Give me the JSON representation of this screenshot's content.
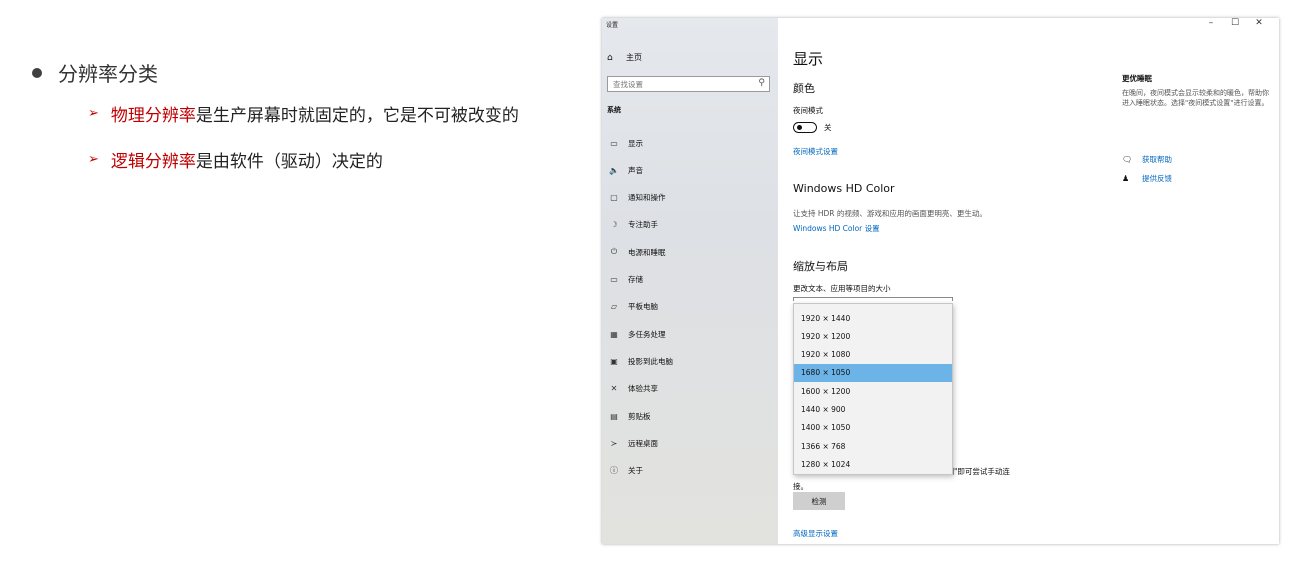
{
  "slide": {
    "bullet": "分辨率分类",
    "sub_items": [
      {
        "highlight": "物理分辨率",
        "rest": "是生产屏幕时就固定的，它是不可被改变的"
      },
      {
        "highlight": "逻辑分辨率",
        "rest": "是由软件（驱动）决定的"
      }
    ]
  },
  "window": {
    "title": "设置",
    "controls": {
      "minimize": "–",
      "maximize": "☐",
      "close": "✕"
    },
    "sidebar": {
      "home": "主页",
      "search_placeholder": "查找设置",
      "section": "系统",
      "items": [
        {
          "label": "显示",
          "icon": "monitor-icon",
          "glyph": "▭"
        },
        {
          "label": "声音",
          "icon": "speaker-icon",
          "glyph": "🔈"
        },
        {
          "label": "通知和操作",
          "icon": "notification-icon",
          "glyph": "▢"
        },
        {
          "label": "专注助手",
          "icon": "moon-icon",
          "glyph": "☽"
        },
        {
          "label": "电源和睡眠",
          "icon": "power-icon",
          "glyph": "⏻"
        },
        {
          "label": "存储",
          "icon": "storage-icon",
          "glyph": "▭"
        },
        {
          "label": "平板电脑",
          "icon": "tablet-icon",
          "glyph": "▱"
        },
        {
          "label": "多任务处理",
          "icon": "multitask-icon",
          "glyph": "▦"
        },
        {
          "label": "投影到此电脑",
          "icon": "project-icon",
          "glyph": "▣"
        },
        {
          "label": "体验共享",
          "icon": "share-icon",
          "glyph": "✕"
        },
        {
          "label": "剪贴板",
          "icon": "clipboard-icon",
          "glyph": "▤"
        },
        {
          "label": "远程桌面",
          "icon": "remote-icon",
          "glyph": "≻"
        },
        {
          "label": "关于",
          "icon": "info-icon",
          "glyph": "ⓘ"
        }
      ]
    },
    "main": {
      "title": "显示",
      "color_heading": "颜色",
      "night_mode_label": "夜间模式",
      "night_mode_state": "关",
      "night_mode_link": "夜间模式设置",
      "hd_heading": "Windows HD Color",
      "hd_desc": "让支持 HDR 的视频、游戏和应用的画面更明亮、更生动。",
      "hd_link": "Windows HD Color 设置",
      "scale_heading": "缩放与布局",
      "scale_desc": "更改文本、应用等项目的大小",
      "resolutions": [
        "1920 × 1440",
        "1920 × 1200",
        "1920 × 1080",
        "1680 × 1050",
        "1600 × 1200",
        "1440 × 900",
        "1400 × 1050",
        "1366 × 768",
        "1280 × 1024"
      ],
      "selected_resolution": "1680 × 1050",
      "detect_text_tail": "择\"检测\"即可尝试手动连",
      "detect_text_line2": "接。",
      "detect_button": "检测",
      "advanced_link": "高级显示设置"
    },
    "right": {
      "title": "更优睡眠",
      "desc": "在晚间，夜间模式会显示较柔和的暖色，帮助你进入睡眠状态。选择\"夜间模式设置\"进行设置。",
      "help_link": "获取帮助",
      "feedback_link": "提供反馈"
    }
  },
  "colors": {
    "accent_red": "#c00000",
    "link_blue": "#0067c0",
    "selection": "#6cb3e7"
  }
}
